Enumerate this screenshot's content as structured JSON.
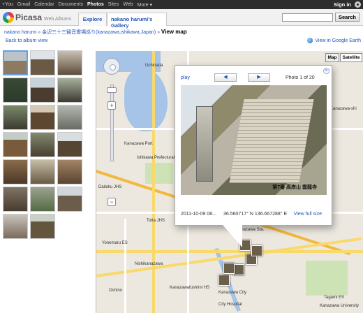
{
  "gbar": {
    "items": [
      "+You",
      "Gmail",
      "Calendar",
      "Documents",
      "Photos",
      "Sites",
      "Web",
      "More ▾"
    ],
    "active": "Photos",
    "signin": "Sign in"
  },
  "header": {
    "logo": "Picasa",
    "logo_sub": "Web Albums",
    "tab_explore": "Explore",
    "tab_gallery": "nakano harumi's Gallery",
    "search_button": "Search",
    "search_placeholder": ""
  },
  "breadcrumb": {
    "user": "nakano harumi",
    "album": "金沢三十三観音霊場巡り(kanazawa,ishikawa,Japan)",
    "current": "View map",
    "back": "Back to album view",
    "earth": "View in Google Earth"
  },
  "map": {
    "btn_map": "Map",
    "btn_sat": "Satellite",
    "labels": {
      "uchinada": "Uchinada",
      "kanazawa_port": "Kanazawa Port",
      "ishikawa_pref": "Ishikawa Prefectural Office",
      "daitoku": "Daitoku JHS",
      "kanazawa_st": "Kanazawa Sta.",
      "kanazawa_city": "Kanazawa City",
      "nishikanazawa": "Nishikanazawa",
      "oshino": "Oshino",
      "kanazawa_fushimi": "Kanazawafushimi HS",
      "tagami": "Tagami ES",
      "kanazawa_univ": "Kanazawa University",
      "city_hospital": "City Hospital",
      "yonemaru": "Yonemaru ES",
      "totta": "Totta JHS",
      "kanazawa_shi": "Kanazawa-shi"
    }
  },
  "popup": {
    "play": "play",
    "prev": "◀",
    "next": "▶",
    "count": "Photo 1 of 20",
    "close": "×",
    "caption": "第7番 高岸山 雲龍寺",
    "date": "2011-10-09 08...",
    "coords": "36.560717° N  136.667288° E",
    "view_full": "View full size"
  }
}
